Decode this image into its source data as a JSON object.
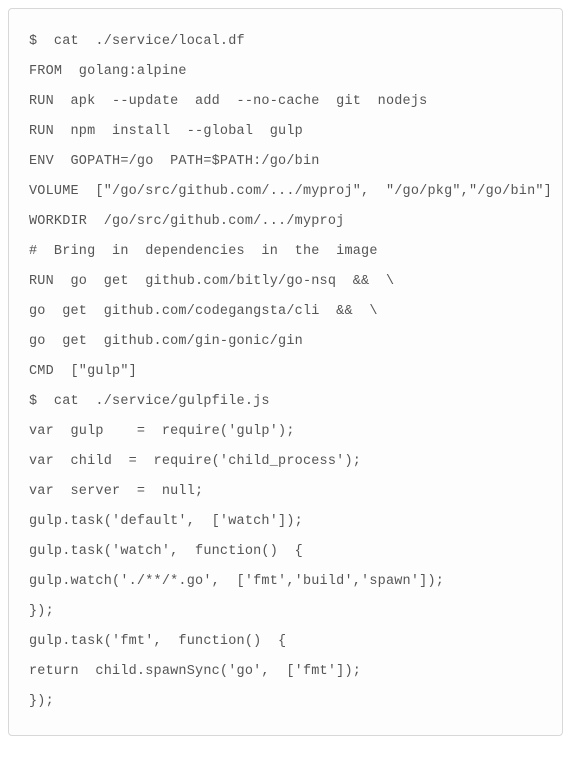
{
  "code": {
    "lines": [
      "$  cat  ./service/local.df",
      "FROM  golang:alpine",
      "RUN  apk  --update  add  --no-cache  git  nodejs",
      "RUN  npm  install  --global  gulp",
      "ENV  GOPATH=/go  PATH=$PATH:/go/bin",
      "VOLUME  [\"/go/src/github.com/.../myproj\",  \"/go/pkg\",\"/go/bin\"]",
      "WORKDIR  /go/src/github.com/.../myproj",
      "#  Bring  in  dependencies  in  the  image",
      "RUN  go  get  github.com/bitly/go-nsq  &&  \\",
      "go  get  github.com/codegangsta/cli  &&  \\",
      "go  get  github.com/gin-gonic/gin",
      "CMD  [\"gulp\"]",
      "$  cat  ./service/gulpfile.js",
      "var  gulp    =  require('gulp');",
      "var  child  =  require('child_process');",
      "var  server  =  null;",
      "gulp.task('default',  ['watch']);",
      "gulp.task('watch',  function()  {",
      "gulp.watch('./**/*.go',  ['fmt','build','spawn']);",
      "});",
      "gulp.task('fmt',  function()  {",
      "return  child.spawnSync('go',  ['fmt']);",
      "});"
    ]
  }
}
